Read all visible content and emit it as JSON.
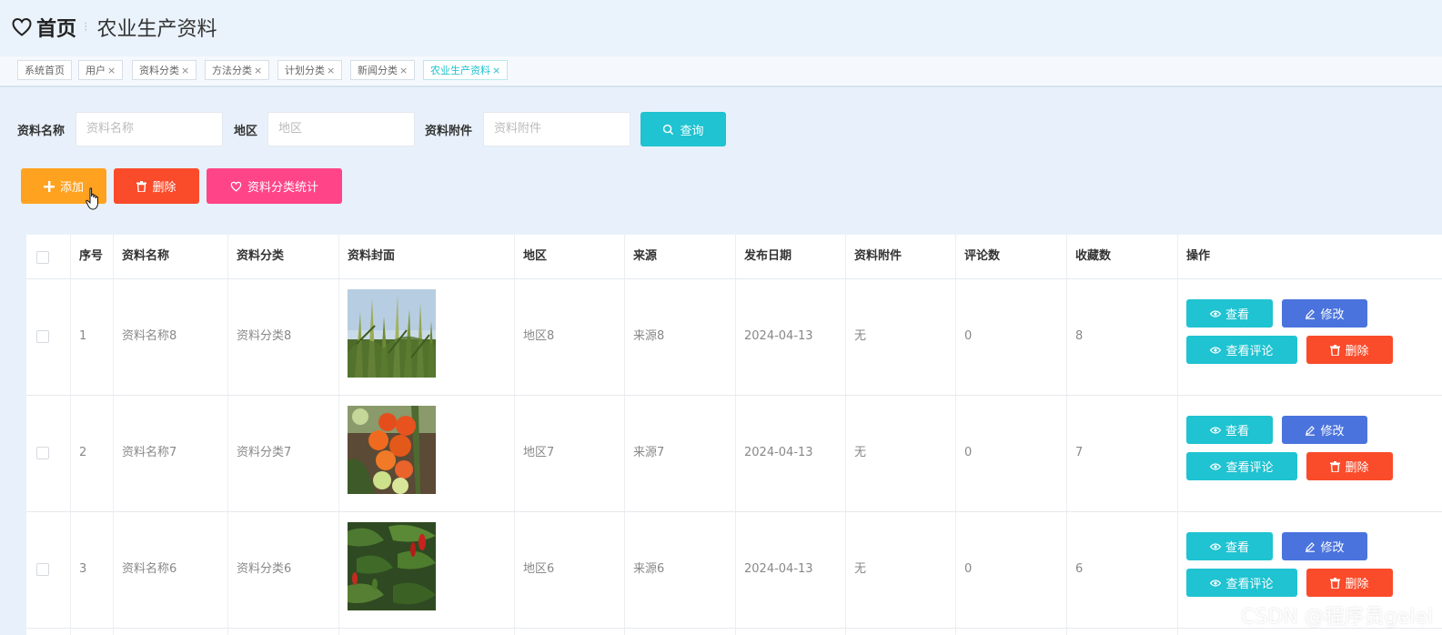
{
  "breadcrumb": {
    "home": "首页",
    "current": "农业生产资料"
  },
  "tabs": [
    {
      "label": "系统首页",
      "closable": false
    },
    {
      "label": "用户",
      "closable": true
    },
    {
      "label": "资料分类",
      "closable": true
    },
    {
      "label": "方法分类",
      "closable": true
    },
    {
      "label": "计划分类",
      "closable": true
    },
    {
      "label": "新闻分类",
      "closable": true
    },
    {
      "label": "农业生产资料",
      "closable": true,
      "active": true
    }
  ],
  "close_glyph": "×",
  "search": {
    "fields": [
      {
        "label": "资料名称",
        "placeholder": "资料名称"
      },
      {
        "label": "地区",
        "placeholder": "地区"
      },
      {
        "label": "资料附件",
        "placeholder": "资料附件"
      }
    ],
    "query_label": "查询"
  },
  "toolbar": {
    "add_label": "添加",
    "delete_label": "删除",
    "stats_label": "资料分类统计"
  },
  "table": {
    "headers": [
      "序号",
      "资料名称",
      "资料分类",
      "资料封面",
      "地区",
      "来源",
      "发布日期",
      "资料附件",
      "评论数",
      "收藏数",
      "操作"
    ],
    "rows": [
      {
        "index": "1",
        "name": "资料名称8",
        "category": "资料分类8",
        "cover": "corn",
        "region": "地区8",
        "source": "来源8",
        "date": "2024-04-13",
        "attachment": "无",
        "comments": "0",
        "favorites": "8"
      },
      {
        "index": "2",
        "name": "资料名称7",
        "category": "资料分类7",
        "cover": "tomato",
        "region": "地区7",
        "source": "来源7",
        "date": "2024-04-13",
        "attachment": "无",
        "comments": "0",
        "favorites": "7"
      },
      {
        "index": "3",
        "name": "资料名称6",
        "category": "资料分类6",
        "cover": "pepper",
        "region": "地区6",
        "source": "来源6",
        "date": "2024-04-13",
        "attachment": "无",
        "comments": "0",
        "favorites": "6"
      }
    ],
    "actions": {
      "view": "查看",
      "edit": "修改",
      "view_comments": "查看评论",
      "delete": "删除"
    }
  },
  "watermark": "CSDN @程序员gelei",
  "colors": {
    "teal": "#1fc3d1",
    "blue": "#4a73dd",
    "red": "#fa4b2a",
    "orange": "#ffa21f",
    "pink": "#ff4587"
  }
}
